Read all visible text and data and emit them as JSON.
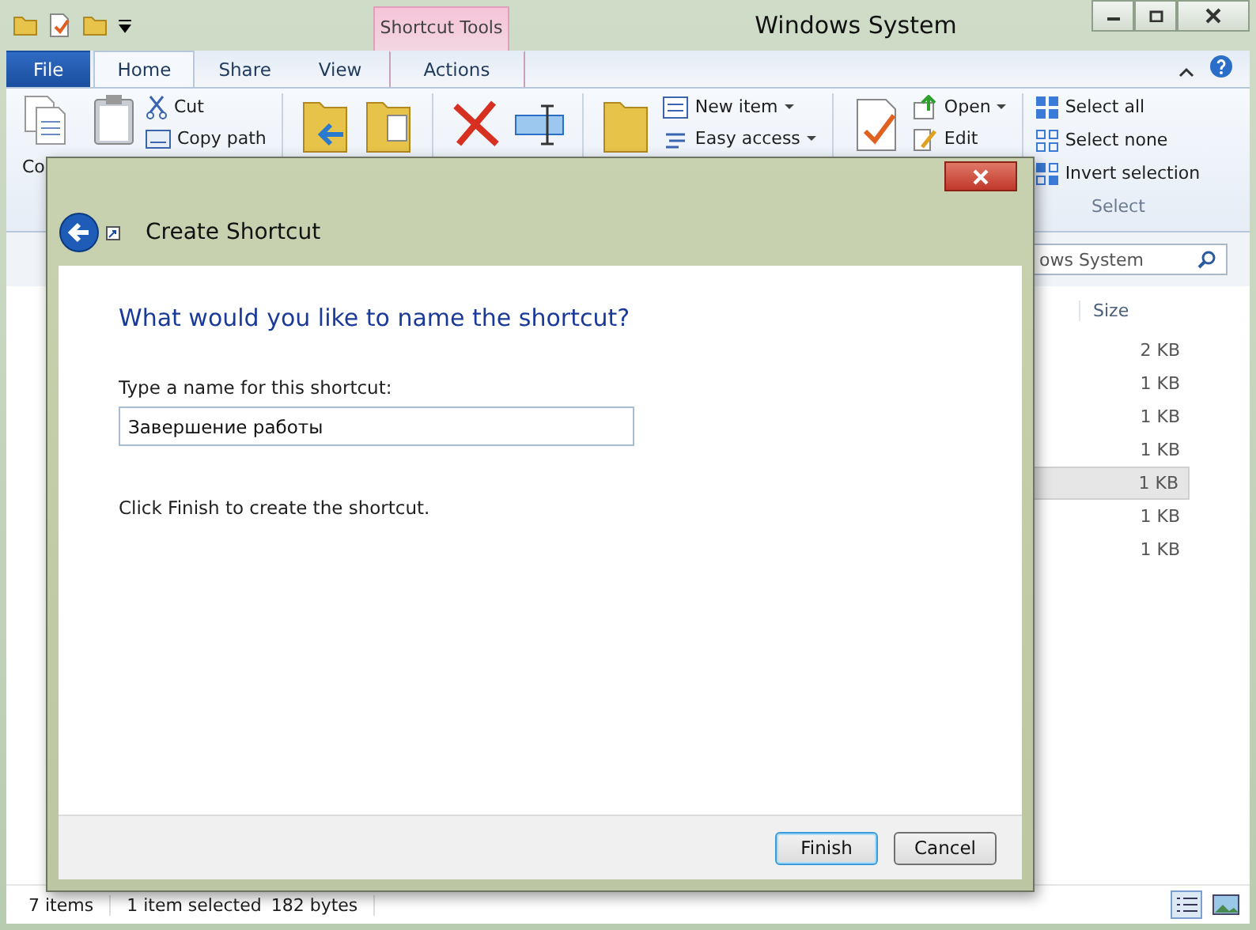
{
  "window": {
    "title": "Windows System",
    "contextual_group": "Shortcut Tools"
  },
  "tabs": [
    {
      "label": "File",
      "kind": "file",
      "selected": false
    },
    {
      "label": "Home",
      "kind": "tab",
      "selected": true
    },
    {
      "label": "Share",
      "kind": "tab",
      "selected": false
    },
    {
      "label": "View",
      "kind": "tab",
      "selected": false
    },
    {
      "label": "Actions",
      "kind": "contextual",
      "selected": false
    }
  ],
  "ribbon": {
    "large_label": "Co",
    "clipboard_items": [
      "Cut",
      "Copy path"
    ],
    "new_items": [
      "New item",
      "Easy access"
    ],
    "open_items": [
      "Open",
      "Edit"
    ],
    "select_items": [
      "Select all",
      "Select none",
      "Invert selection"
    ],
    "select_group": "Select"
  },
  "search": {
    "placeholder": "ows System"
  },
  "file_list": {
    "size_header": "Size",
    "rows": [
      {
        "size": "2 KB",
        "selected": false
      },
      {
        "size": "1 KB",
        "selected": false
      },
      {
        "size": "1 KB",
        "selected": false
      },
      {
        "size": "1 KB",
        "selected": false
      },
      {
        "size": "1 KB",
        "selected": true
      },
      {
        "size": "1 KB",
        "selected": false
      },
      {
        "size": "1 KB",
        "selected": false
      }
    ]
  },
  "status_bar": {
    "items": "7 items",
    "selection": "1 item selected",
    "size": "182 bytes"
  },
  "dialog": {
    "title": "Create Shortcut",
    "question": "What would you like to name the shortcut?",
    "field_label": "Type a name for this shortcut:",
    "field_value": "Завершение работы",
    "note": "Click Finish to create the shortcut.",
    "buttons": [
      {
        "label": "Finish",
        "default": true
      },
      {
        "label": "Cancel",
        "default": false
      }
    ]
  }
}
